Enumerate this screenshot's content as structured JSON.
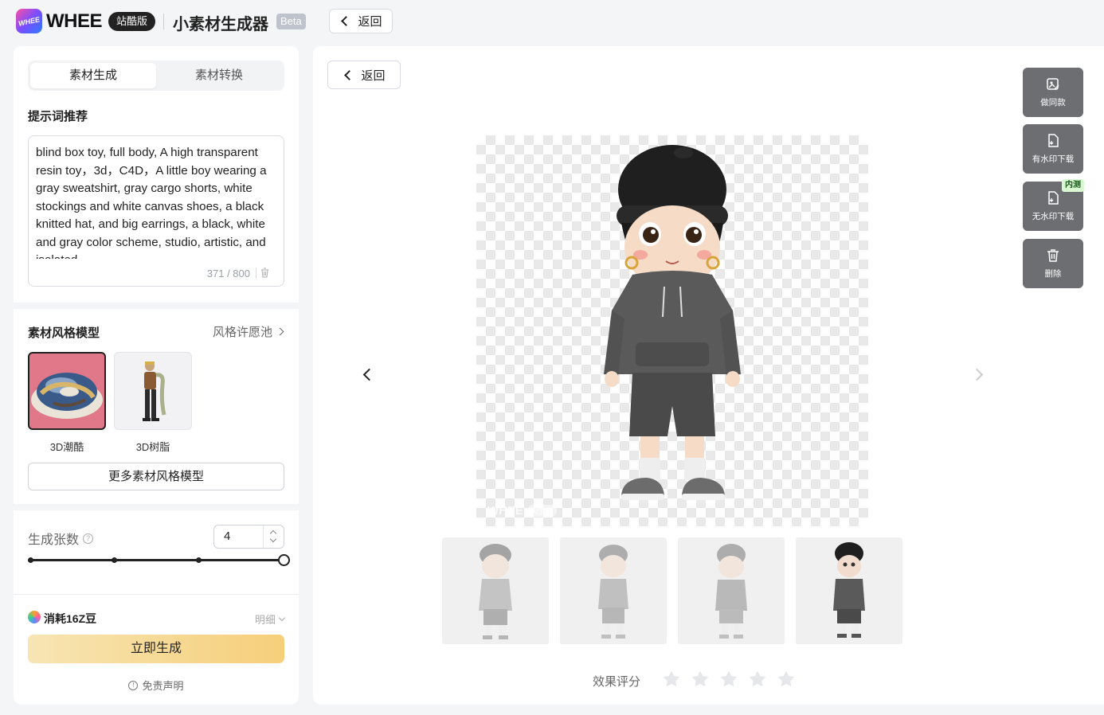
{
  "header": {
    "logo_text": "WHEE",
    "brand": "WHEE",
    "edition": "站酷版",
    "app_title": "小素材生成器",
    "beta": "Beta",
    "back_label": "返回"
  },
  "sidebar": {
    "tabs": [
      {
        "label": "素材生成",
        "active": true
      },
      {
        "label": "素材转换",
        "active": false
      }
    ],
    "prompt_section_title": "提示词推荐",
    "prompt_text": "blind box toy, full body, A high transparent resin toy，3d，C4D，A little boy wearing a gray sweatshirt, gray cargo shorts, white stockings and white canvas shoes, a black knitted hat, and big earrings, a black, white and gray color scheme, studio, artistic, and isolated",
    "prompt_counter": "371 / 800",
    "style_section_title": "素材风格模型",
    "style_pool_link": "风格许愿池",
    "styles": [
      {
        "label": "3D潮酷",
        "selected": true
      },
      {
        "label": "3D树脂",
        "selected": false
      }
    ],
    "more_styles_button": "更多素材风格模型",
    "count_label": "生成张数",
    "count_value": "4",
    "count_slider": {
      "min": 1,
      "max": 4,
      "value": 4
    },
    "cost_text": "消耗16Z豆",
    "detail_label": "明细",
    "generate_button": "立即生成",
    "disclaimer": "免责声明"
  },
  "main": {
    "back_label": "返回",
    "watermark_brand": "WHEE",
    "watermark_tag": "AI生成",
    "thumbnails_count": 4,
    "selected_thumbnail": 4,
    "rating_label": "效果评分",
    "rating_stars": 5,
    "actions": [
      {
        "label": "做同款",
        "icon": "image-edit-icon"
      },
      {
        "label": "有水印下载",
        "icon": "download-file-icon"
      },
      {
        "label": "无水印下载",
        "icon": "download-file-icon",
        "badge": "内测"
      },
      {
        "label": "删除",
        "icon": "trash-icon"
      }
    ]
  },
  "colors": {
    "generate_gradient_start": "#f7e5b4",
    "generate_gradient_end": "#f6cf7a",
    "action_button_bg": "#6d6e72",
    "badge_bg": "#d9f9d3"
  }
}
